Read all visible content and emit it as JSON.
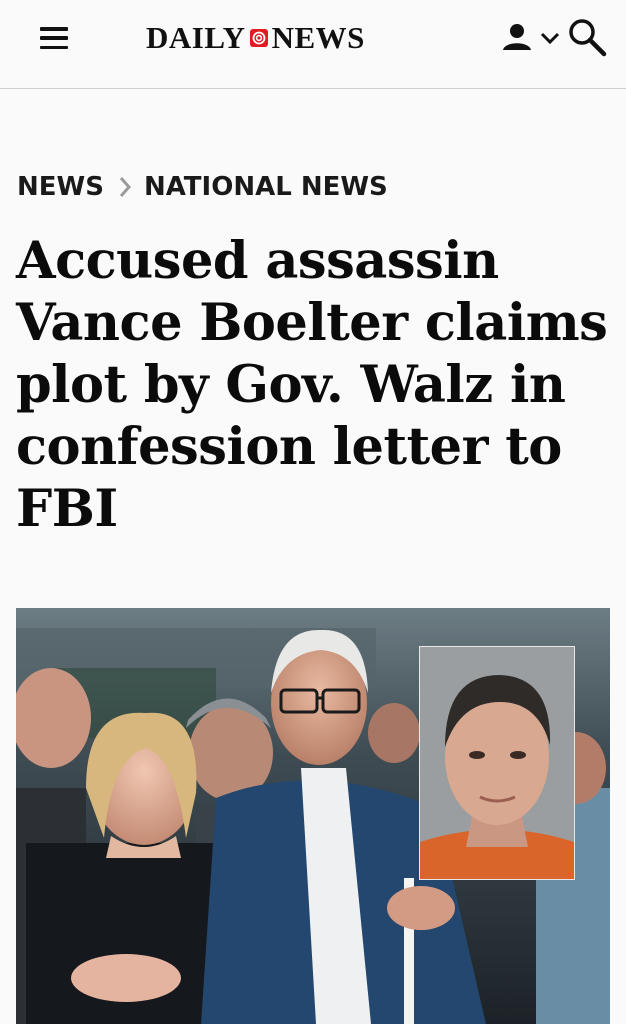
{
  "header": {
    "logo_left": "DAILY",
    "logo_right": "NEWS",
    "menu_icon": "hamburger-menu-icon",
    "account_icon": "user-icon",
    "chevron_icon": "chevron-down-icon",
    "search_icon": "search-icon",
    "brand_color": "#e11b22"
  },
  "breadcrumb": {
    "items": [
      "NEWS",
      "NATIONAL NEWS"
    ],
    "separator_icon": "chevron-right-icon"
  },
  "article": {
    "headline": "Accused assassin Vance Boelter claims plot by Gov. Walz in confession letter to FBI"
  }
}
